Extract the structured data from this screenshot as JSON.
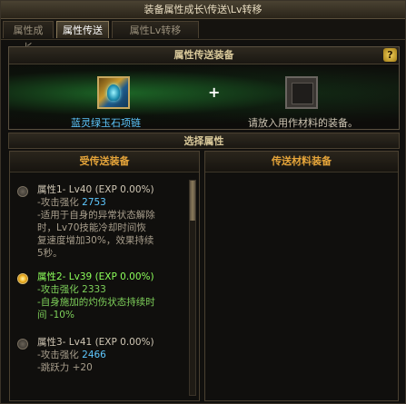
{
  "window": {
    "title": "装备属性成长\\传送\\Lv转移"
  },
  "tabs": [
    {
      "label": "属性成长"
    },
    {
      "label": "属性传送"
    },
    {
      "label": "属性Lv转移"
    }
  ],
  "transfer_panel": {
    "title": "属性传送装备",
    "help": "?",
    "source_item_name": "蓝灵绿玉石项链",
    "plus": "+",
    "material_placeholder": "请放入用作材料的装备。"
  },
  "select_attributes": {
    "title": "选择属性",
    "left_header": "受传送装备",
    "right_header": "传送材料装备",
    "entries": [
      {
        "title": "属性1- Lv40 (EXP 0.00%)",
        "selected": false,
        "stat_label": "-攻击强化",
        "stat_value": "2753",
        "desc": [
          "-适用于自身的异常状态解除",
          "时，Lv70技能冷却时间恢",
          "复速度增加30%，效果持续",
          "5秒。"
        ]
      },
      {
        "title": "属性2- Lv39 (EXP 0.00%)",
        "selected": true,
        "stat_label": "-攻击强化",
        "stat_value": "2333",
        "desc": [
          "-自身施加的灼伤状态持续时",
          "间 -10%"
        ]
      },
      {
        "title": "属性3- Lv41 (EXP 0.00%)",
        "selected": false,
        "stat_label": "-攻击强化",
        "stat_value": "2466",
        "desc": [
          "-跳跃力 +20"
        ]
      }
    ]
  },
  "colors": {
    "accent": "#e6a53a",
    "item_name": "#5ec8ff",
    "selected": "#8cff5a"
  }
}
